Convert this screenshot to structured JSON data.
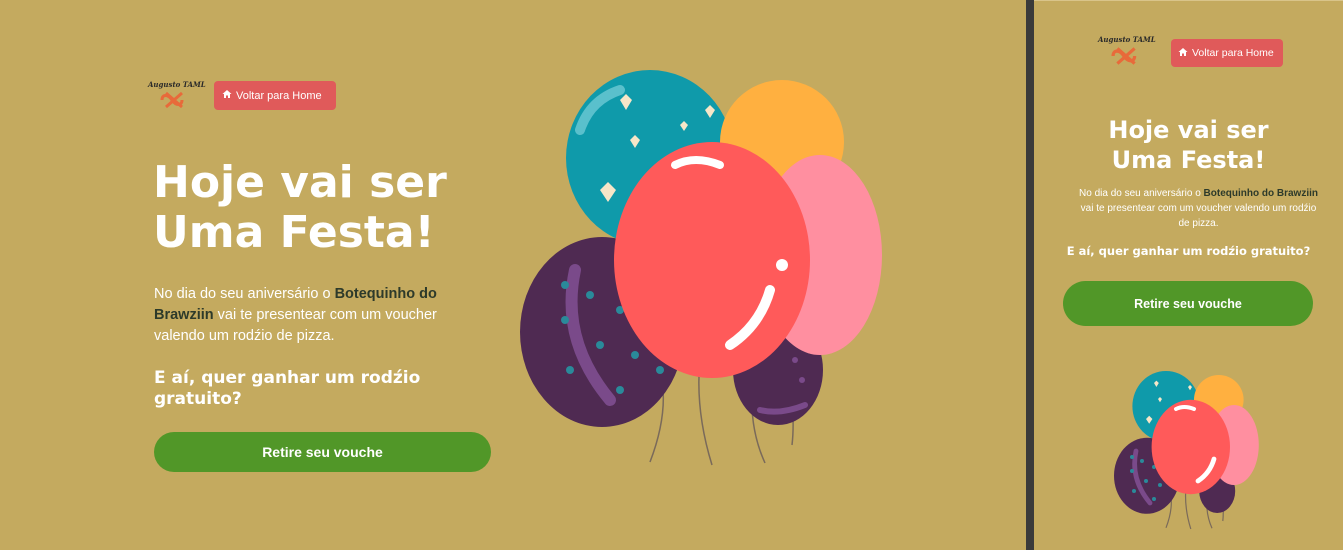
{
  "brand": {
    "logo_text": "Augusto TAML"
  },
  "nav": {
    "home_label": "Voltar para Home"
  },
  "hero": {
    "title_line1": "Hoje vai ser",
    "title_line2": "Uma Festa!",
    "desc_before": "No dia do seu aniversário o ",
    "desc_bold": "Botequinho do Brawziin",
    "desc_after": " vai te presentear com um voucher valendo um rodźio de pizza.",
    "question": "E aí, quer ganhar um rodźio gratuito?",
    "cta_label": "Retire seu vouche"
  },
  "colors": {
    "background": "#c4aa5f",
    "home_button": "#e05a5a",
    "cta_button": "#519728",
    "accent_text": "#2d3a2a"
  },
  "icons": {
    "home": "home-icon",
    "logo_mark": "logo-mark-icon",
    "illustration": "balloons-illustration"
  }
}
